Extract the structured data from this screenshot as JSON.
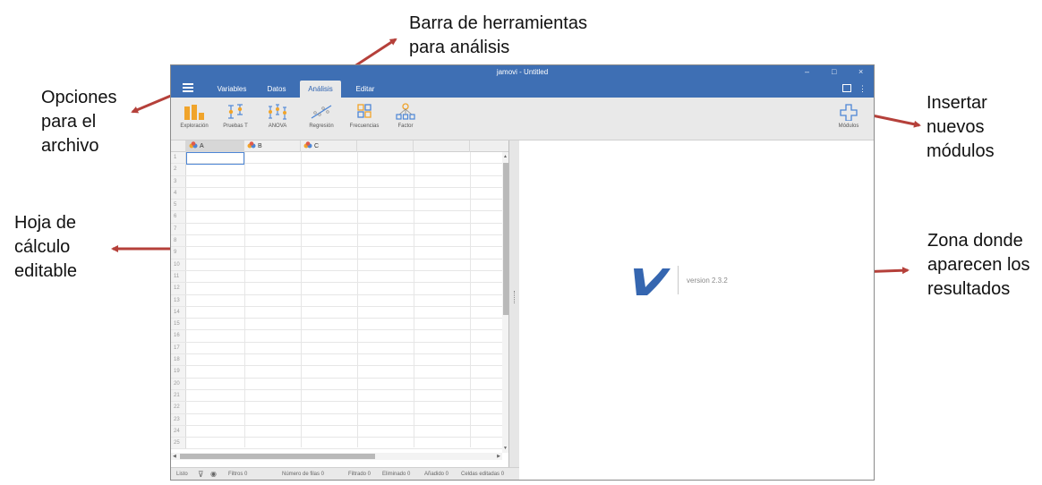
{
  "annotations": {
    "toolbar": [
      "Barra de herramientas",
      "para análisis"
    ],
    "file_options": [
      "Opciones",
      "para el",
      "archivo"
    ],
    "modules": [
      "Insertar",
      "nuevos",
      "módulos"
    ],
    "spreadsheet": [
      "Hoja de",
      "cálculo",
      "editable"
    ],
    "results_zone": [
      "Zona donde",
      "aparecen los",
      "resultados"
    ]
  },
  "window": {
    "title": "jamovi - Untitled",
    "minimize": "–",
    "maximize": "□",
    "close": "×"
  },
  "tabs": [
    "Variables",
    "Datos",
    "Análisis",
    "Editar"
  ],
  "active_tab": "Análisis",
  "ribbon": {
    "buttons": [
      {
        "label": "Exploración",
        "icon": "bar-chart-icon"
      },
      {
        "label": "Pruebas T",
        "icon": "t-test-icon"
      },
      {
        "label": "ANOVA",
        "icon": "anova-icon"
      },
      {
        "label": "Regresión",
        "icon": "regression-icon"
      },
      {
        "label": "Frecuencias",
        "icon": "frequencies-icon"
      },
      {
        "label": "Factor",
        "icon": "factor-icon"
      }
    ],
    "modules_label": "Módulos"
  },
  "spreadsheet": {
    "columns": [
      "A",
      "B",
      "C"
    ],
    "row_numbers": [
      "1",
      "2",
      "3",
      "4",
      "5",
      "6",
      "7",
      "8",
      "9",
      "10",
      "11",
      "12",
      "13",
      "14",
      "15",
      "16",
      "17",
      "18",
      "19",
      "20",
      "21",
      "22",
      "23",
      "24",
      "25"
    ]
  },
  "results": {
    "version": "version 2.3.2"
  },
  "status": {
    "ready": "Listo",
    "filters": "Filtros 0",
    "row_count": "Número de filas 0",
    "filtered": "Filtrado 0",
    "deleted": "Eliminado 0",
    "added": "Añadido 0",
    "edited": "Celdas editadas 0"
  },
  "colors": {
    "titlebar": "#3e6fb4",
    "arrow": "#b5403a",
    "accent": "#4d86d6",
    "logo": "#3566b0"
  }
}
